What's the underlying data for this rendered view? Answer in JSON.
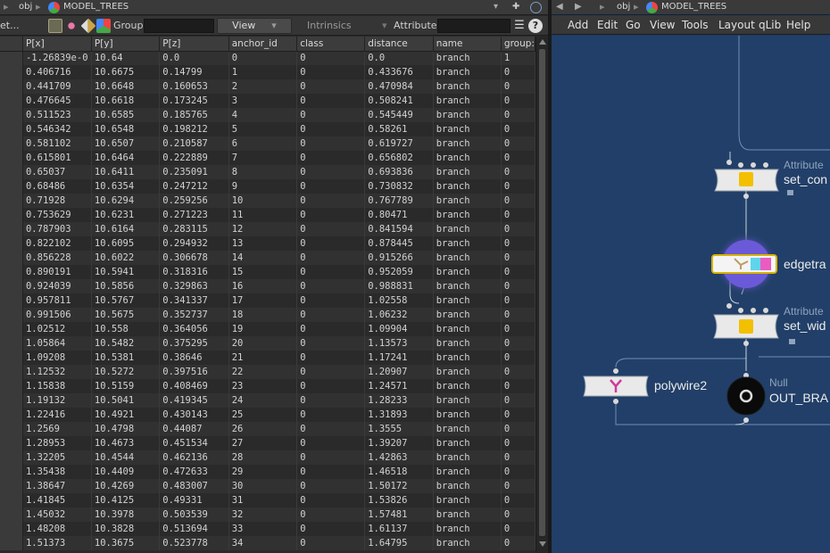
{
  "colors": {
    "network_bg": "#213f68",
    "edgetrace_glow": "#6f5bd6",
    "null_node": "#0a0a0a"
  },
  "left_pane": {
    "path": {
      "obj": "obj",
      "node": "MODEL_TREES"
    },
    "toolbar": {
      "node_label": "et...",
      "group_label": "Group:",
      "group_value": "",
      "view_label": "View",
      "intrinsics_label": "Intrinsics",
      "attributes_label": "Attributes:",
      "attributes_value": "",
      "help_icon": "?"
    },
    "table": {
      "columns": [
        "P[x]",
        "P[y]",
        "P[z]",
        "anchor_id",
        "class",
        "distance",
        "name",
        "group:"
      ],
      "rows": [
        [
          "-1.26839e-0",
          "10.64",
          "0.0",
          "0",
          "0",
          "0.0",
          "branch",
          "1"
        ],
        [
          "0.406716",
          "10.6675",
          "0.14799",
          "1",
          "0",
          "0.433676",
          "branch",
          "0"
        ],
        [
          "0.441709",
          "10.6648",
          "0.160653",
          "2",
          "0",
          "0.470984",
          "branch",
          "0"
        ],
        [
          "0.476645",
          "10.6618",
          "0.173245",
          "3",
          "0",
          "0.508241",
          "branch",
          "0"
        ],
        [
          "0.511523",
          "10.6585",
          "0.185765",
          "4",
          "0",
          "0.545449",
          "branch",
          "0"
        ],
        [
          "0.546342",
          "10.6548",
          "0.198212",
          "5",
          "0",
          "0.58261",
          "branch",
          "0"
        ],
        [
          "0.581102",
          "10.6507",
          "0.210587",
          "6",
          "0",
          "0.619727",
          "branch",
          "0"
        ],
        [
          "0.615801",
          "10.6464",
          "0.222889",
          "7",
          "0",
          "0.656802",
          "branch",
          "0"
        ],
        [
          "0.65037",
          "10.6411",
          "0.235091",
          "8",
          "0",
          "0.693836",
          "branch",
          "0"
        ],
        [
          "0.68486",
          "10.6354",
          "0.247212",
          "9",
          "0",
          "0.730832",
          "branch",
          "0"
        ],
        [
          "0.71928",
          "10.6294",
          "0.259256",
          "10",
          "0",
          "0.767789",
          "branch",
          "0"
        ],
        [
          "0.753629",
          "10.6231",
          "0.271223",
          "11",
          "0",
          "0.80471",
          "branch",
          "0"
        ],
        [
          "0.787903",
          "10.6164",
          "0.283115",
          "12",
          "0",
          "0.841594",
          "branch",
          "0"
        ],
        [
          "0.822102",
          "10.6095",
          "0.294932",
          "13",
          "0",
          "0.878445",
          "branch",
          "0"
        ],
        [
          "0.856228",
          "10.6022",
          "0.306678",
          "14",
          "0",
          "0.915266",
          "branch",
          "0"
        ],
        [
          "0.890191",
          "10.5941",
          "0.318316",
          "15",
          "0",
          "0.952059",
          "branch",
          "0"
        ],
        [
          "0.924039",
          "10.5856",
          "0.329863",
          "16",
          "0",
          "0.988831",
          "branch",
          "0"
        ],
        [
          "0.957811",
          "10.5767",
          "0.341337",
          "17",
          "0",
          "1.02558",
          "branch",
          "0"
        ],
        [
          "0.991506",
          "10.5675",
          "0.352737",
          "18",
          "0",
          "1.06232",
          "branch",
          "0"
        ],
        [
          "1.02512",
          "10.558",
          "0.364056",
          "19",
          "0",
          "1.09904",
          "branch",
          "0"
        ],
        [
          "1.05864",
          "10.5482",
          "0.375295",
          "20",
          "0",
          "1.13573",
          "branch",
          "0"
        ],
        [
          "1.09208",
          "10.5381",
          "0.38646",
          "21",
          "0",
          "1.17241",
          "branch",
          "0"
        ],
        [
          "1.12532",
          "10.5272",
          "0.397516",
          "22",
          "0",
          "1.20907",
          "branch",
          "0"
        ],
        [
          "1.15838",
          "10.5159",
          "0.408469",
          "23",
          "0",
          "1.24571",
          "branch",
          "0"
        ],
        [
          "1.19132",
          "10.5041",
          "0.419345",
          "24",
          "0",
          "1.28233",
          "branch",
          "0"
        ],
        [
          "1.22416",
          "10.4921",
          "0.430143",
          "25",
          "0",
          "1.31893",
          "branch",
          "0"
        ],
        [
          "1.2569",
          "10.4798",
          "0.44087",
          "26",
          "0",
          "1.3555",
          "branch",
          "0"
        ],
        [
          "1.28953",
          "10.4673",
          "0.451534",
          "27",
          "0",
          "1.39207",
          "branch",
          "0"
        ],
        [
          "1.32205",
          "10.4544",
          "0.462136",
          "28",
          "0",
          "1.42863",
          "branch",
          "0"
        ],
        [
          "1.35438",
          "10.4409",
          "0.472633",
          "29",
          "0",
          "1.46518",
          "branch",
          "0"
        ],
        [
          "1.38647",
          "10.4269",
          "0.483007",
          "30",
          "0",
          "1.50172",
          "branch",
          "0"
        ],
        [
          "1.41845",
          "10.4125",
          "0.49331",
          "31",
          "0",
          "1.53826",
          "branch",
          "0"
        ],
        [
          "1.45032",
          "10.3978",
          "0.503539",
          "32",
          "0",
          "1.57481",
          "branch",
          "0"
        ],
        [
          "1.48208",
          "10.3828",
          "0.513694",
          "33",
          "0",
          "1.61137",
          "branch",
          "0"
        ],
        [
          "1.51373",
          "10.3675",
          "0.523778",
          "34",
          "0",
          "1.64795",
          "branch",
          "0"
        ]
      ]
    }
  },
  "right_pane": {
    "path": {
      "obj": "obj",
      "node": "MODEL_TREES"
    },
    "menu": [
      "Add",
      "Edit",
      "Go",
      "View",
      "Tools",
      "Layout",
      "qLib",
      "Help"
    ],
    "nodes": {
      "set_con": {
        "type": "Attribute",
        "name": "set_con"
      },
      "edgetra": {
        "name": "edgetra"
      },
      "set_wid": {
        "type": "Attribute",
        "name": "set_wid"
      },
      "polywire": {
        "name": "polywire2"
      },
      "out": {
        "type": "Null",
        "name": "OUT_BRA"
      }
    }
  }
}
